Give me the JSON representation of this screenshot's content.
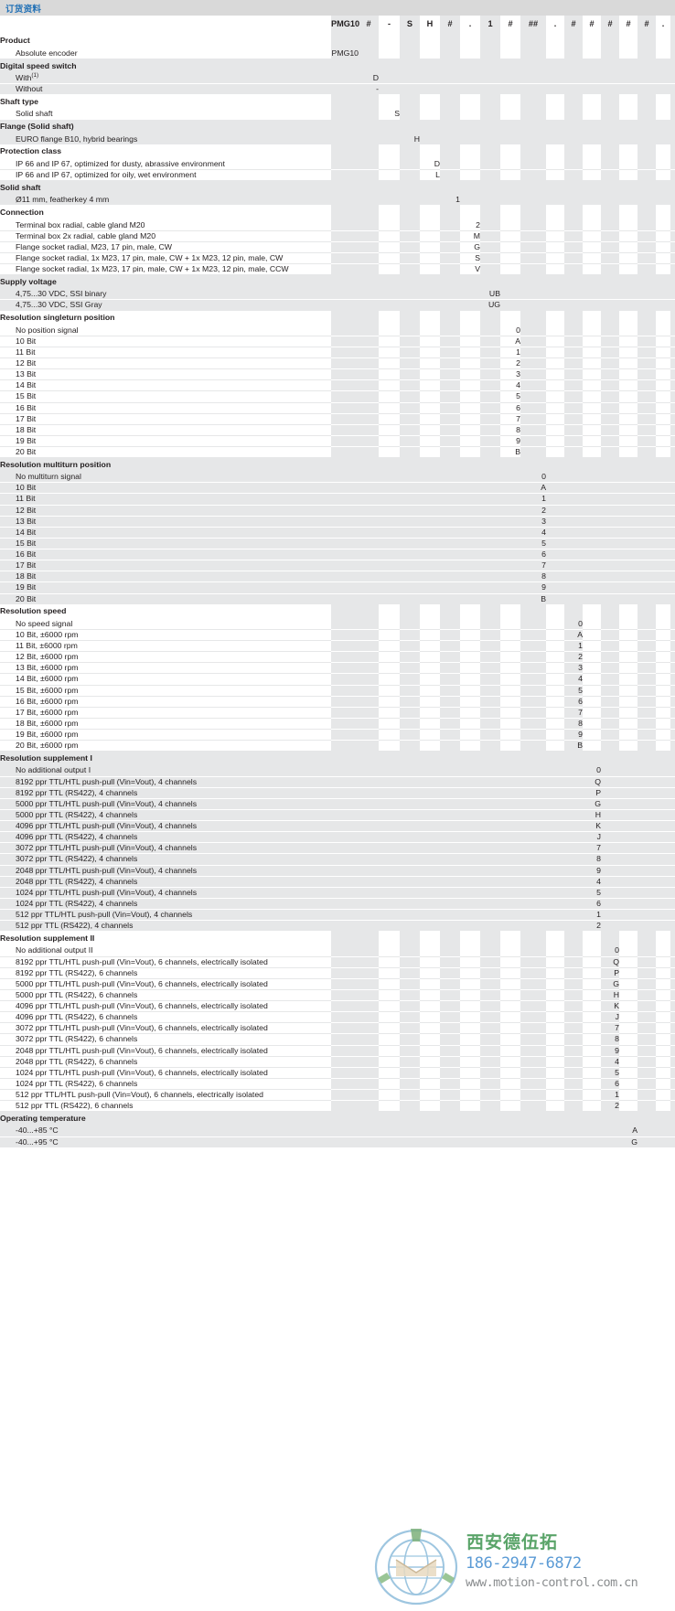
{
  "titlebar": {
    "title": "订货资料"
  },
  "header": {
    "code_parts": [
      "PMG10",
      "#",
      "-",
      "S",
      "H",
      "#",
      ".",
      "1",
      "#",
      "##",
      ".",
      "#",
      "#",
      "#",
      "#",
      "#",
      ".",
      "#"
    ]
  },
  "watermark": {
    "company_cn": "西安德伍拓",
    "phone": "186-2947-6872",
    "url": "www.motion-control.com.cn"
  },
  "sections": [
    {
      "heading": "Product",
      "rows": [
        {
          "label": "Absolute encoder",
          "code": "PMG10",
          "col": 0
        }
      ]
    },
    {
      "heading": "Digital speed switch",
      "rows": [
        {
          "label": "With",
          "sup": "(1)",
          "code": "D",
          "col": 1
        },
        {
          "label": "Without",
          "code": "-",
          "col": 1
        }
      ]
    },
    {
      "heading": "Shaft type",
      "rows": [
        {
          "label": "Solid shaft",
          "code": "S",
          "col": 2
        }
      ]
    },
    {
      "heading": "Flange (Solid shaft)",
      "rows": [
        {
          "label": "EURO flange B10, hybrid bearings",
          "code": "H",
          "col": 3
        }
      ]
    },
    {
      "heading": "Protection class",
      "rows": [
        {
          "label": "IP 66 and IP 67, optimized for dusty, abrassive environment",
          "code": "D",
          "col": 4
        },
        {
          "label": "IP 66 and IP 67, optimized for oily, wet environment",
          "code": "L",
          "col": 4
        }
      ]
    },
    {
      "heading": "Solid shaft",
      "rows": [
        {
          "label": "Ø11 mm, featherkey 4 mm",
          "code": "1",
          "col": 5
        }
      ]
    },
    {
      "heading": "Connection",
      "rows": [
        {
          "label": "Terminal box radial, cable gland M20",
          "code": "2",
          "col": 6
        },
        {
          "label": "Terminal box 2x radial, cable gland M20",
          "code": "M",
          "col": 6
        },
        {
          "label": "Flange socket radial, M23, 17 pin, male, CW",
          "code": "G",
          "col": 6
        },
        {
          "label": "Flange socket radial, 1x M23, 17 pin, male, CW + 1x M23, 12 pin, male, CW",
          "code": "S",
          "col": 6
        },
        {
          "label": "Flange socket radial, 1x M23, 17 pin, male, CW + 1x M23, 12 pin, male, CCW",
          "code": "V",
          "col": 6
        }
      ]
    },
    {
      "heading": "Supply voltage",
      "rows": [
        {
          "label": "4,75...30 VDC, SSI binary",
          "code": "UB",
          "col": 7
        },
        {
          "label": "4,75...30 VDC, SSI Gray",
          "code": "UG",
          "col": 7
        }
      ]
    },
    {
      "heading": "Resolution singleturn position",
      "rows": [
        {
          "label": "No position signal",
          "code": "0",
          "col": 8
        },
        {
          "label": "10 Bit",
          "code": "A",
          "col": 8
        },
        {
          "label": "11 Bit",
          "code": "1",
          "col": 8
        },
        {
          "label": "12 Bit",
          "code": "2",
          "col": 8
        },
        {
          "label": "13 Bit",
          "code": "3",
          "col": 8
        },
        {
          "label": "14 Bit",
          "code": "4",
          "col": 8
        },
        {
          "label": "15 Bit",
          "code": "5",
          "col": 8
        },
        {
          "label": "16 Bit",
          "code": "6",
          "col": 8
        },
        {
          "label": "17 Bit",
          "code": "7",
          "col": 8
        },
        {
          "label": "18 Bit",
          "code": "8",
          "col": 8
        },
        {
          "label": "19 Bit",
          "code": "9",
          "col": 8
        },
        {
          "label": "20 Bit",
          "code": "B",
          "col": 8
        }
      ]
    },
    {
      "heading": "Resolution multiturn position",
      "rows": [
        {
          "label": "No multiturn signal",
          "code": "0",
          "col": 9
        },
        {
          "label": "10 Bit",
          "code": "A",
          "col": 9
        },
        {
          "label": "11 Bit",
          "code": "1",
          "col": 9
        },
        {
          "label": "12 Bit",
          "code": "2",
          "col": 9
        },
        {
          "label": "13 Bit",
          "code": "3",
          "col": 9
        },
        {
          "label": "14 Bit",
          "code": "4",
          "col": 9
        },
        {
          "label": "15 Bit",
          "code": "5",
          "col": 9
        },
        {
          "label": "16 Bit",
          "code": "6",
          "col": 9
        },
        {
          "label": "17 Bit",
          "code": "7",
          "col": 9
        },
        {
          "label": "18 Bit",
          "code": "8",
          "col": 9
        },
        {
          "label": "19 Bit",
          "code": "9",
          "col": 9
        },
        {
          "label": "20 Bit",
          "code": "B",
          "col": 9
        }
      ]
    },
    {
      "heading": "Resolution speed",
      "rows": [
        {
          "label": "No speed signal",
          "code": "0",
          "col": 11
        },
        {
          "label": "10 Bit, ±6000 rpm",
          "code": "A",
          "col": 11
        },
        {
          "label": "11 Bit, ±6000 rpm",
          "code": "1",
          "col": 11
        },
        {
          "label": "12 Bit, ±6000 rpm",
          "code": "2",
          "col": 11
        },
        {
          "label": "13 Bit, ±6000 rpm",
          "code": "3",
          "col": 11
        },
        {
          "label": "14 Bit, ±6000 rpm",
          "code": "4",
          "col": 11
        },
        {
          "label": "15 Bit, ±6000 rpm",
          "code": "5",
          "col": 11
        },
        {
          "label": "16 Bit, ±6000 rpm",
          "code": "6",
          "col": 11
        },
        {
          "label": "17 Bit, ±6000 rpm",
          "code": "7",
          "col": 11
        },
        {
          "label": "18 Bit, ±6000 rpm",
          "code": "8",
          "col": 11
        },
        {
          "label": "19 Bit, ±6000 rpm",
          "code": "9",
          "col": 11
        },
        {
          "label": "20 Bit, ±6000 rpm",
          "code": "B",
          "col": 11
        }
      ]
    },
    {
      "heading": "Resolution supplement I",
      "rows": [
        {
          "label": "No additional output I",
          "code": "0",
          "col": 12
        },
        {
          "label": "8192 ppr TTL/HTL push-pull (Vin=Vout), 4 channels",
          "code": "Q",
          "col": 12
        },
        {
          "label": "8192 ppr TTL (RS422), 4 channels",
          "code": "P",
          "col": 12
        },
        {
          "label": "5000 ppr TTL/HTL push-pull (Vin=Vout), 4 channels",
          "code": "G",
          "col": 12
        },
        {
          "label": "5000 ppr TTL (RS422), 4 channels",
          "code": "H",
          "col": 12
        },
        {
          "label": "4096 ppr TTL/HTL push-pull (Vin=Vout), 4 channels",
          "code": "K",
          "col": 12
        },
        {
          "label": "4096 ppr TTL (RS422), 4 channels",
          "code": "J",
          "col": 12
        },
        {
          "label": "3072 ppr TTL/HTL push-pull (Vin=Vout), 4 channels",
          "code": "7",
          "col": 12
        },
        {
          "label": "3072 ppr TTL (RS422), 4 channels",
          "code": "8",
          "col": 12
        },
        {
          "label": "2048 ppr TTL/HTL push-pull (Vin=Vout), 4 channels",
          "code": "9",
          "col": 12
        },
        {
          "label": "2048 ppr TTL (RS422), 4 channels",
          "code": "4",
          "col": 12
        },
        {
          "label": "1024 ppr TTL/HTL push-pull (Vin=Vout), 4 channels",
          "code": "5",
          "col": 12
        },
        {
          "label": "1024 ppr TTL (RS422), 4 channels",
          "code": "6",
          "col": 12
        },
        {
          "label": "512 ppr TTL/HTL push-pull (Vin=Vout), 4 channels",
          "code": "1",
          "col": 12
        },
        {
          "label": "512 ppr TTL (RS422), 4 channels",
          "code": "2",
          "col": 12
        }
      ]
    },
    {
      "heading": "Resolution supplement II",
      "rows": [
        {
          "label": "No additional output II",
          "code": "0",
          "col": 13
        },
        {
          "label": "8192 ppr TTL/HTL push-pull (Vin=Vout), 6 channels, electrically isolated",
          "code": "Q",
          "col": 13
        },
        {
          "label": "8192 ppr TTL (RS422), 6 channels",
          "code": "P",
          "col": 13
        },
        {
          "label": "5000 ppr TTL/HTL push-pull (Vin=Vout), 6 channels, electrically isolated",
          "code": "G",
          "col": 13
        },
        {
          "label": "5000 ppr TTL (RS422), 6 channels",
          "code": "H",
          "col": 13
        },
        {
          "label": "4096 ppr TTL/HTL push-pull (Vin=Vout), 6 channels, electrically isolated",
          "code": "K",
          "col": 13
        },
        {
          "label": "4096 ppr TTL (RS422), 6 channels",
          "code": "J",
          "col": 13
        },
        {
          "label": "3072 ppr TTL/HTL push-pull (Vin=Vout), 6 channels, electrically isolated",
          "code": "7",
          "col": 13
        },
        {
          "label": "3072 ppr TTL (RS422), 6 channels",
          "code": "8",
          "col": 13
        },
        {
          "label": "2048 ppr TTL/HTL push-pull (Vin=Vout), 6 channels, electrically isolated",
          "code": "9",
          "col": 13
        },
        {
          "label": "2048 ppr TTL (RS422), 6 channels",
          "code": "4",
          "col": 13
        },
        {
          "label": "1024 ppr TTL/HTL push-pull (Vin=Vout), 6 channels, electrically isolated",
          "code": "5",
          "col": 13
        },
        {
          "label": "1024 ppr TTL (RS422), 6 channels",
          "code": "6",
          "col": 13
        },
        {
          "label": "512 ppr TTL/HTL push-pull (Vin=Vout), 6 channels, electrically isolated",
          "code": "1",
          "col": 13
        },
        {
          "label": "512 ppr TTL (RS422), 6 channels",
          "code": "2",
          "col": 13
        }
      ]
    },
    {
      "heading": "Operating temperature",
      "rows": [
        {
          "label": "-40...+85 °C",
          "code": "A",
          "col": 14
        },
        {
          "label": "-40...+95 °C",
          "code": "G",
          "col": 14
        }
      ]
    }
  ]
}
